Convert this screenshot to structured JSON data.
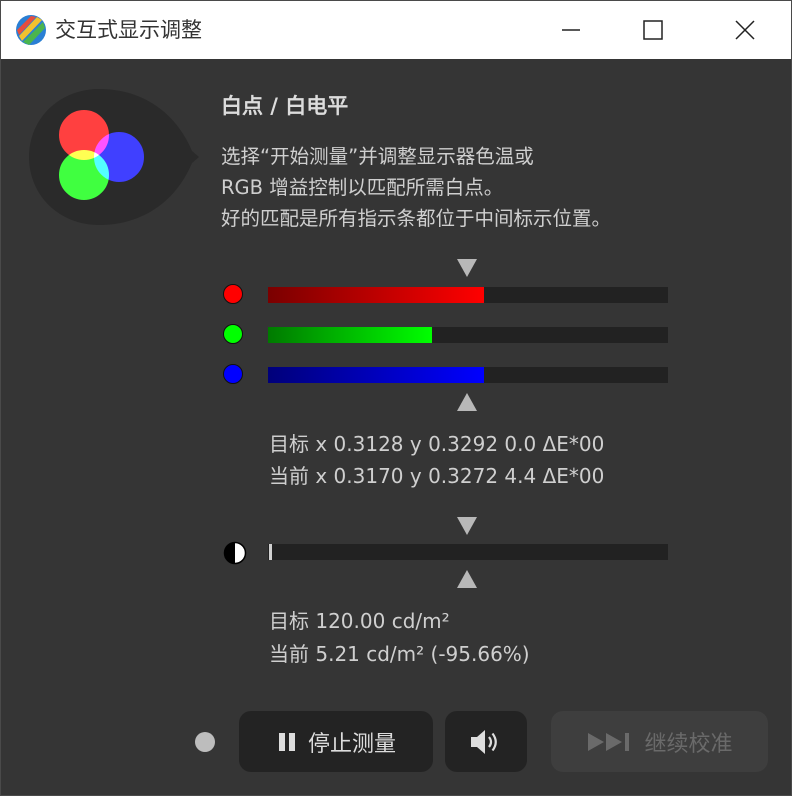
{
  "window": {
    "title": "交互式显示调整"
  },
  "panel": {
    "heading": "白点 / 白电平",
    "description": [
      "选择“开始测量”并调整显示器色温或",
      "RGB 增益控制以匹配所需白点。",
      "好的匹配是所有指示条都位于中间标示位置。"
    ]
  },
  "rgb_bars": [
    {
      "channel": "red",
      "color": "#ff0000",
      "level_fraction": 0.54
    },
    {
      "channel": "green",
      "color": "#00ff00",
      "level_fraction": 0.41
    },
    {
      "channel": "blue",
      "color": "#0000ff",
      "level_fraction": 0.54
    }
  ],
  "chromaticity": {
    "target_text": "目标 x 0.3128 y 0.3292 0.0 ΔE*00",
    "current_text": "当前 x 0.3170 y 0.3272 4.4 ΔE*00"
  },
  "luminance": {
    "level_fraction": 0.005,
    "target_text": "目标 120.00 cd/m²",
    "current_text": "当前 5.21 cd/m² (-95.66%)"
  },
  "controls": {
    "stop_label": "停止测量",
    "continue_label": "继续校准"
  },
  "colors": {
    "background": "#353535",
    "bar_track": "#222222",
    "button_bg": "#232323",
    "disabled_text": "#6a6a6a"
  }
}
